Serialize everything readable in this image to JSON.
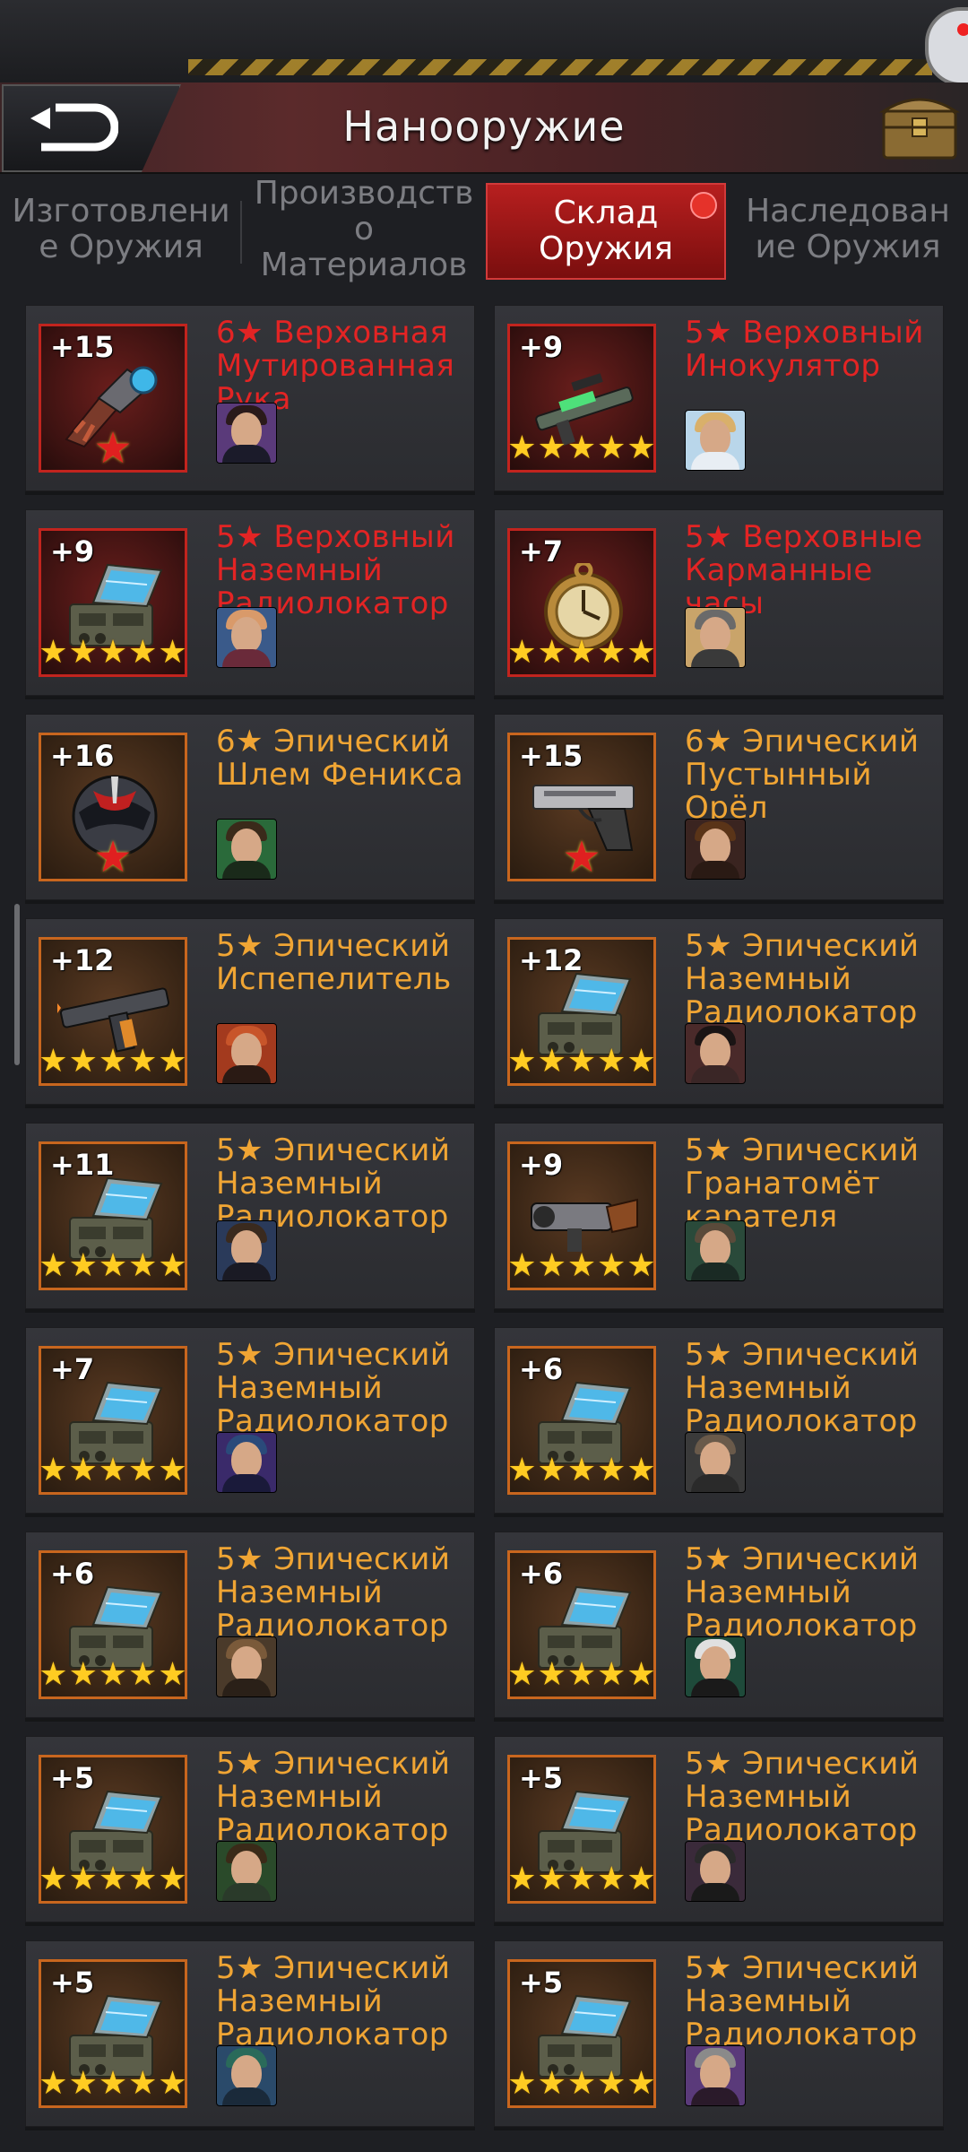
{
  "header": {
    "title": "Нанооружие"
  },
  "tabs": [
    {
      "label": "Изготовлени\nе Оружия",
      "active": false
    },
    {
      "label": "Производств\nо\nМатериалов",
      "active": false
    },
    {
      "label": "Склад\nОружия",
      "active": true,
      "has_notification": true
    },
    {
      "label": "Наследован\nие Оружия",
      "active": false
    }
  ],
  "colors": {
    "legendary_name": "#e32424",
    "epic_name": "#f0a534",
    "active_tab": "#b71f1f"
  },
  "items": [
    {
      "level": "+15",
      "name": "6★ Верховная Мутированная Рука",
      "rarity": "legendary",
      "stars": 6,
      "icon": "mutated-arm-icon",
      "avatar": "hero-avatar-male-dark"
    },
    {
      "level": "+9",
      "name": "5★ Верховный Инокулятор",
      "rarity": "legendary",
      "stars": 5,
      "icon": "inoculator-gun-icon",
      "avatar": "hero-avatar-nurse"
    },
    {
      "level": "+9",
      "name": "5★ Верховный Наземный Радиолокатор",
      "rarity": "legendary",
      "stars": 5,
      "icon": "ground-radar-icon",
      "avatar": "hero-avatar-female-pink"
    },
    {
      "level": "+7",
      "name": "5★ Верховные Карманные часы",
      "rarity": "legendary",
      "stars": 5,
      "icon": "pocket-watch-icon",
      "avatar": "hero-avatar-male-old"
    },
    {
      "level": "+16",
      "name": "6★ Эпический Шлем Феникса",
      "rarity": "epic",
      "stars": 6,
      "icon": "phoenix-helmet-icon",
      "avatar": "hero-avatar-male-green"
    },
    {
      "level": "+15",
      "name": "6★ Эпический Пустынный Орёл",
      "rarity": "epic",
      "stars": 6,
      "icon": "desert-eagle-icon",
      "avatar": "hero-avatar-male-cowboy"
    },
    {
      "level": "+12",
      "name": "5★ Эпический Испепелитель",
      "rarity": "epic",
      "stars": 5,
      "icon": "incinerator-gun-icon",
      "avatar": "hero-avatar-female-red"
    },
    {
      "level": "+12",
      "name": "5★ Эпический Наземный Радиолокатор",
      "rarity": "epic",
      "stars": 5,
      "icon": "ground-radar-icon",
      "avatar": "hero-avatar-female-dark"
    },
    {
      "level": "+11",
      "name": "5★ Эпический Наземный Радиолокатор",
      "rarity": "epic",
      "stars": 5,
      "icon": "ground-radar-icon",
      "avatar": "hero-avatar-male-longhair"
    },
    {
      "level": "+9",
      "name": "5★ Эпический Гранатомёт карателя",
      "rarity": "epic",
      "stars": 5,
      "icon": "grenade-launcher-icon",
      "avatar": "hero-avatar-male-bandana"
    },
    {
      "level": "+7",
      "name": "5★ Эпический Наземный Радиолокатор",
      "rarity": "epic",
      "stars": 5,
      "icon": "ground-radar-icon",
      "avatar": "hero-avatar-robot"
    },
    {
      "level": "+6",
      "name": "5★ Эпический Наземный Радиолокатор",
      "rarity": "epic",
      "stars": 5,
      "icon": "ground-radar-icon",
      "avatar": "hero-avatar-male-cap"
    },
    {
      "level": "+6",
      "name": "5★ Эпический Наземный Радиолокатор",
      "rarity": "epic",
      "stars": 5,
      "icon": "ground-radar-icon",
      "avatar": "hero-avatar-female-blonde"
    },
    {
      "level": "+6",
      "name": "5★ Эпический Наземный Радиолокатор",
      "rarity": "epic",
      "stars": 5,
      "icon": "ground-radar-icon",
      "avatar": "hero-avatar-female-mask"
    },
    {
      "level": "+5",
      "name": "5★ Эпический Наземный Радиолокатор",
      "rarity": "epic",
      "stars": 5,
      "icon": "ground-radar-icon",
      "avatar": "hero-avatar-male-soldier"
    },
    {
      "level": "+5",
      "name": "5★ Эпический Наземный Радиолокатор",
      "rarity": "epic",
      "stars": 5,
      "icon": "ground-radar-icon",
      "avatar": "hero-avatar-male-gasmask"
    },
    {
      "level": "+5",
      "name": "5★ Эпический Наземный Радиолокатор",
      "rarity": "epic",
      "stars": 5,
      "icon": "ground-radar-icon",
      "avatar": "hero-avatar-female-cyber"
    },
    {
      "level": "+5",
      "name": "5★ Эпический Наземный Радиолокатор",
      "rarity": "epic",
      "stars": 5,
      "icon": "ground-radar-icon",
      "avatar": "hero-avatar-male-beard"
    }
  ]
}
